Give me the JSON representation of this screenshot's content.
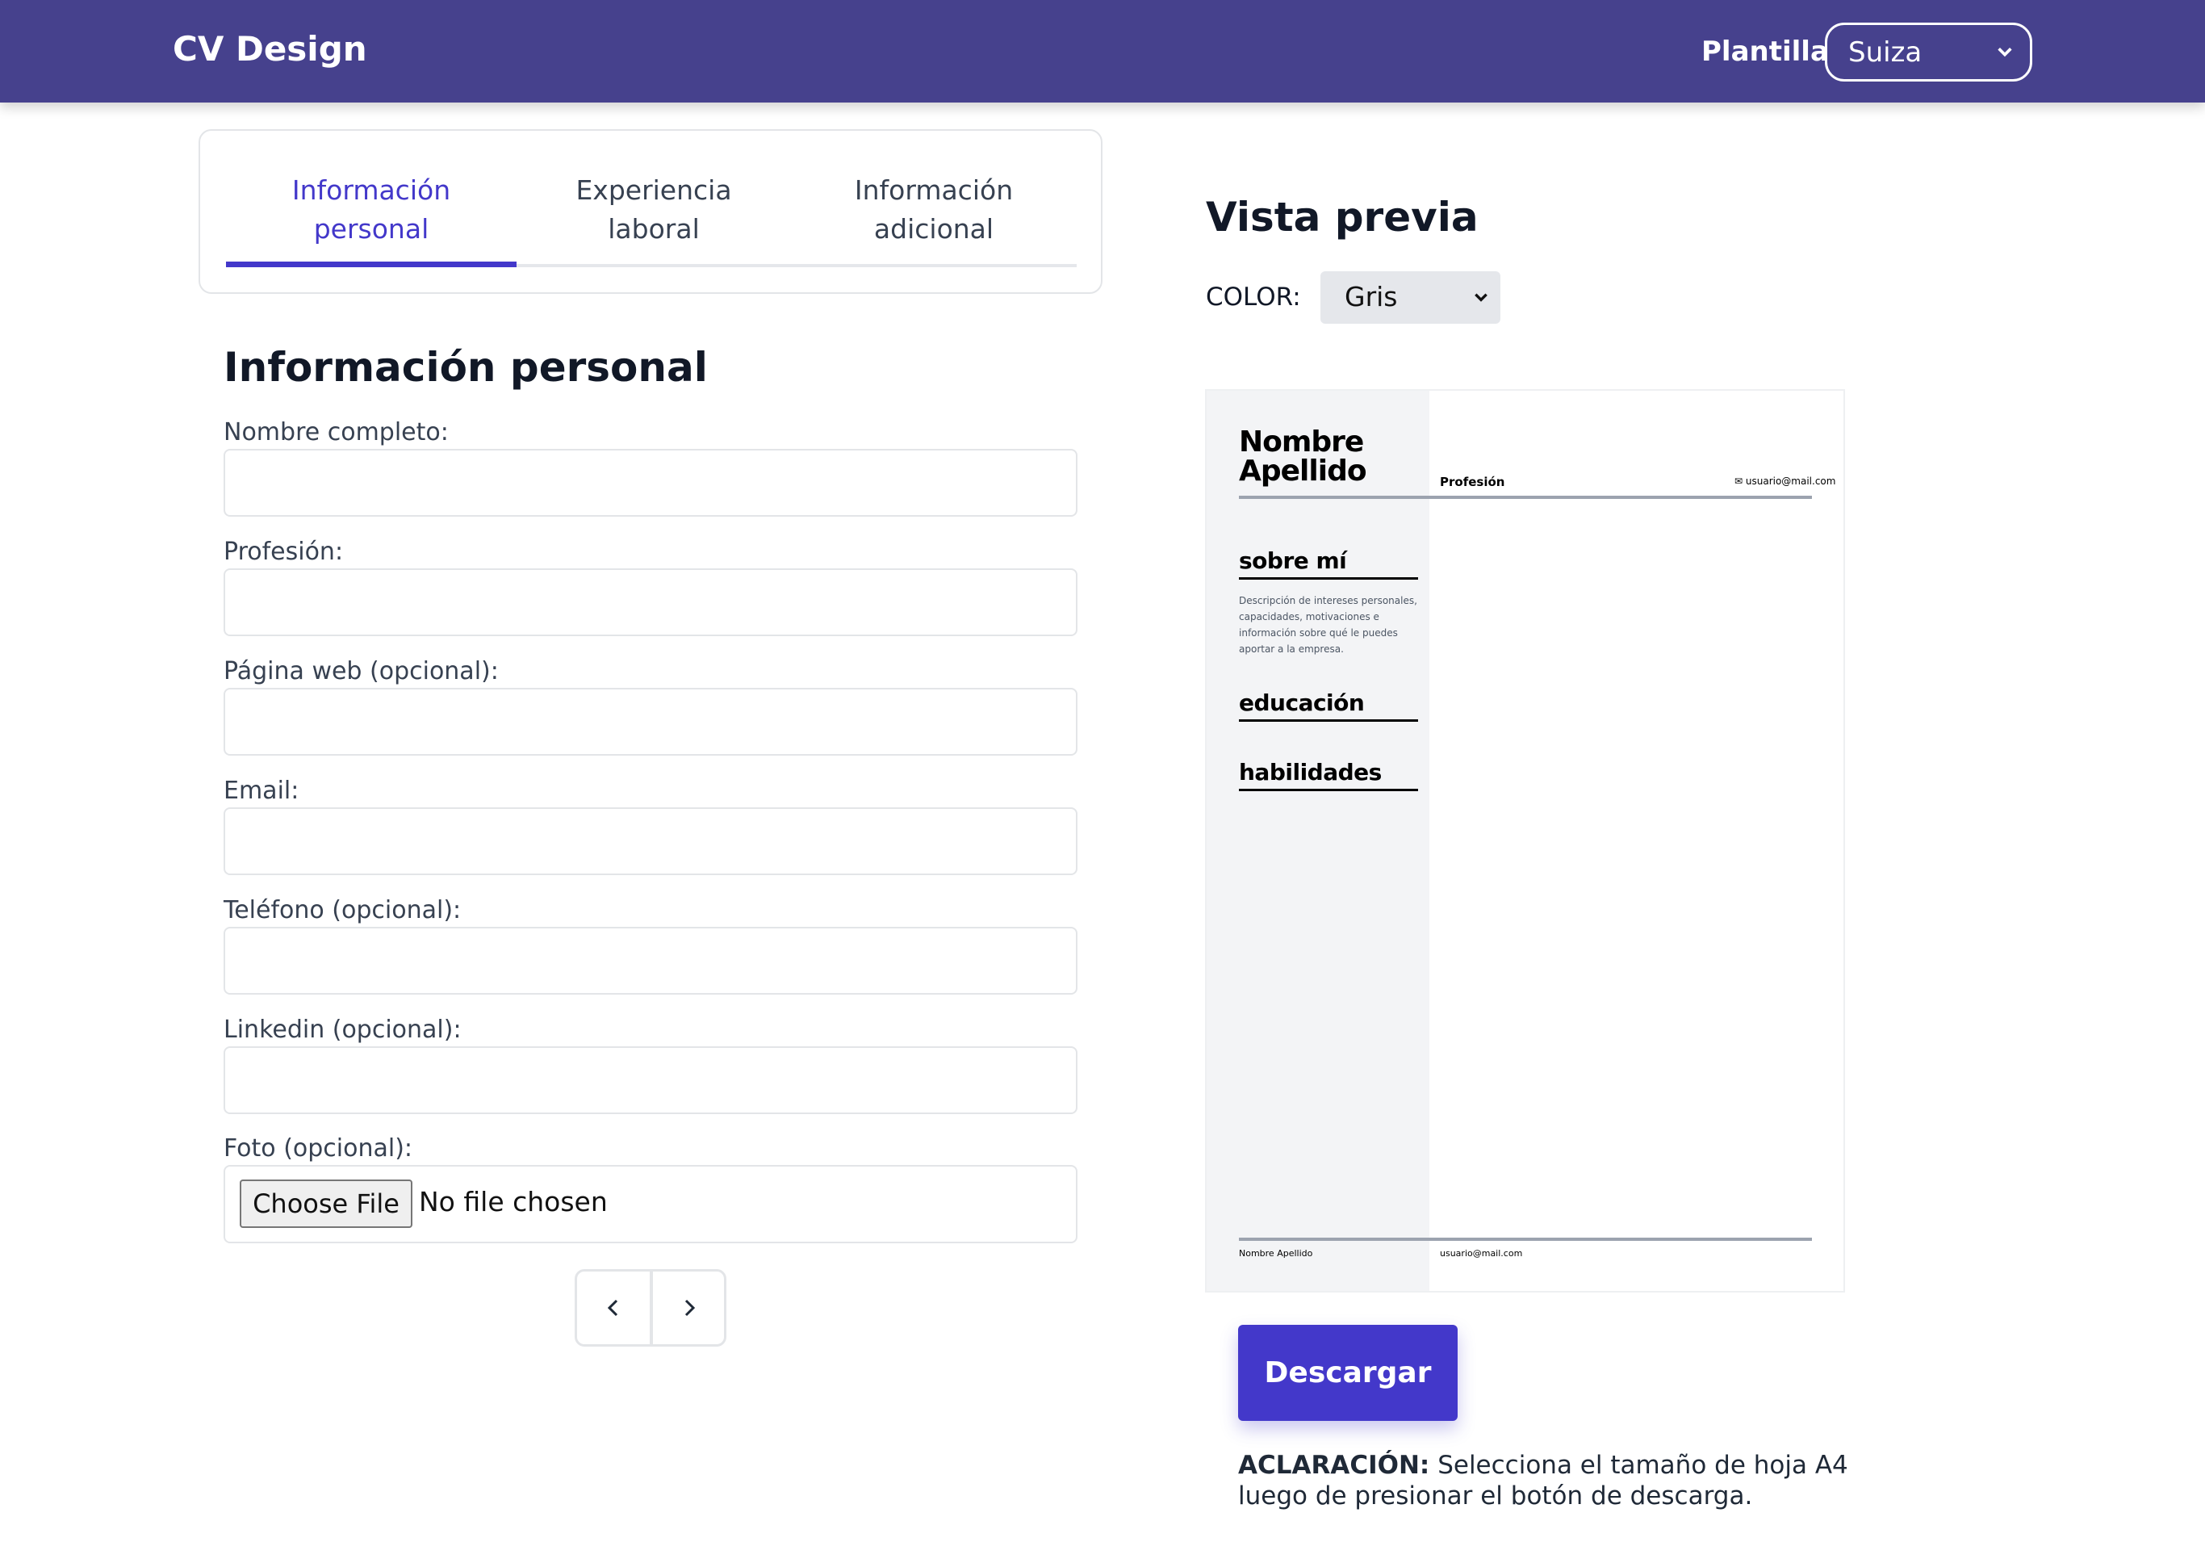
{
  "header": {
    "brand": "CV Design",
    "template_label": "Plantilla:",
    "template_value": "Suiza",
    "bg_color": "#46418d"
  },
  "tabs": [
    {
      "line1": "Información",
      "line2": "personal",
      "active": true
    },
    {
      "line1": "Experiencia",
      "line2": "laboral",
      "active": false
    },
    {
      "line1": "Información",
      "line2": "adicional",
      "active": false
    }
  ],
  "form": {
    "title": "Información personal",
    "fields": [
      {
        "label": "Nombre completo:",
        "value": ""
      },
      {
        "label": "Profesión:",
        "value": ""
      },
      {
        "label": "Página web (opcional):",
        "value": ""
      },
      {
        "label": "Email:",
        "value": ""
      },
      {
        "label": "Teléfono (opcional):",
        "value": ""
      },
      {
        "label": "Linkedin (opcional):",
        "value": ""
      }
    ],
    "photo_label": "Foto (opcional):",
    "file_button": "Choose File",
    "file_status": "No file chosen",
    "prev_icon": "chevron-left-icon",
    "next_icon": "chevron-right-icon"
  },
  "preview": {
    "title": "Vista previa",
    "color_label": "COLOR:",
    "color_value": "Gris",
    "cv": {
      "name_first": "Nombre",
      "name_last": "Apellido",
      "profession": "Profesión",
      "email_top": "usuario@mail.com",
      "about_title": "sobre mí",
      "about_text": "Descripción de intereses personales, capacidades, motivaciones e información sobre qué le puedes aportar a la empresa.",
      "education_title": "educación",
      "skills_title": "habilidades",
      "footer_name": "Nombre Apellido",
      "footer_email": "usuario@mail.com"
    },
    "download_label": "Descargar",
    "note_bold": "ACLARACIÓN:",
    "note_text": " Selecciona el tamaño de hoja A4 luego de presionar el botón de descarga.",
    "accent_color": "#4338ca"
  }
}
